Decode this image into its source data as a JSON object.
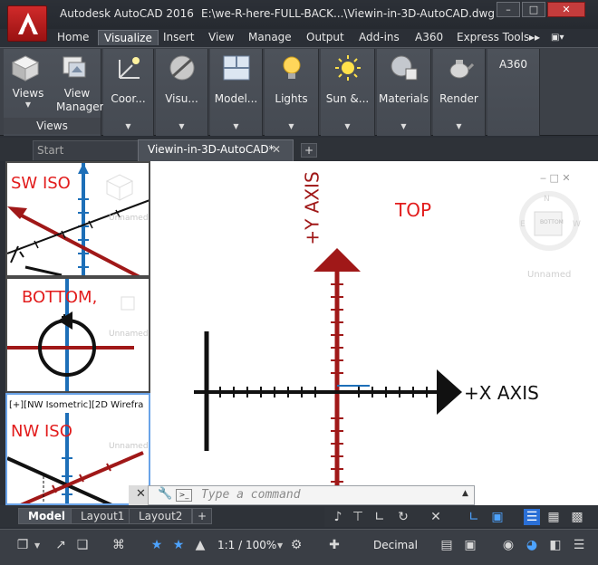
{
  "window": {
    "app_title": "Autodesk AutoCAD 2016",
    "file_title": "E:\\we-R-here-FULL-BACK...\\Viewin-in-3D-AutoCAD.dwg",
    "minimize": "–",
    "restore": "□",
    "close": "✕"
  },
  "ribbon": {
    "tabs": [
      "Home",
      "Visualize",
      "Insert",
      "View",
      "Manage",
      "Output",
      "Add-ins",
      "A360",
      "Express Tools"
    ],
    "more": "▸▸",
    "panels": [
      {
        "label": "Views",
        "icon": "cube-icon"
      },
      {
        "label": "View Manager",
        "icon": "view-manager-icon"
      },
      {
        "label": "Coor...",
        "icon": "ucs-icon"
      },
      {
        "label": "Visu...",
        "icon": "visual-styles-icon"
      },
      {
        "label": "Model...",
        "icon": "model-viewports-icon"
      },
      {
        "label": "Lights",
        "icon": "light-bulb-icon"
      },
      {
        "label": "Sun &...",
        "icon": "sun-icon"
      },
      {
        "label": "Materials",
        "icon": "materials-icon"
      },
      {
        "label": "Render",
        "icon": "teapot-icon"
      },
      {
        "label": "A360",
        "icon": ""
      }
    ],
    "views_group_label": "Views"
  },
  "doc_tabs": {
    "start": "Start",
    "file": "Viewin-in-3D-AutoCAD*",
    "close": "✕",
    "add": "+"
  },
  "viewports": {
    "sw": {
      "label": "SW ISO",
      "unnamed": "Unnamed"
    },
    "bottom": {
      "label": "BOTTOM,",
      "unnamed": "Unnamed"
    },
    "nw": {
      "header": "[+][NW Isometric][2D Wirefra",
      "label": "NW ISO",
      "unnamed": "Unnamed"
    },
    "main": {
      "label": "TOP",
      "x_axis": "+X AXIS",
      "y_axis": "+Y AXIS",
      "cube_face": "BOTTOM",
      "unnamed": "Unnamed"
    }
  },
  "command": {
    "placeholder": "Type a command",
    "prompt_icon": ">_"
  },
  "layout_tabs": [
    "Model",
    "Layout1",
    "Layout2"
  ],
  "status": {
    "scale": "1:1 / 100%",
    "units": "Decimal"
  },
  "colors": {
    "axis_red": "#a01818",
    "axis_blue": "#1d6fb8",
    "label_red": "#e21c1c",
    "accent_blue": "#2a6fd6"
  }
}
